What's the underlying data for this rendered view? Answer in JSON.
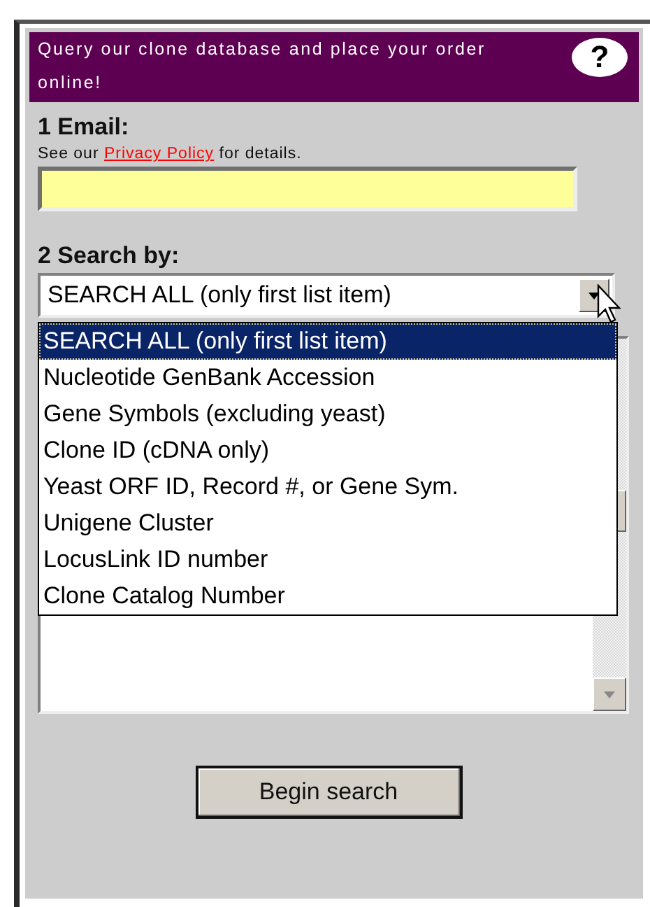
{
  "header": {
    "text": "Query our clone database and place your order online!",
    "help": "?"
  },
  "email": {
    "label": "1 Email:",
    "note_before": "See our ",
    "note_link": "Privacy Policy",
    "note_after": " for details."
  },
  "search_by": {
    "label": "2 Search by:",
    "value": "SEARCH ALL (only first list item)",
    "expanded": true,
    "options": [
      {
        "label": "SEARCH ALL (only first list item)",
        "selected": true
      },
      {
        "label": "Nucleotide GenBank Accession",
        "selected": false
      },
      {
        "label": "Gene Symbols (excluding yeast)",
        "selected": false
      },
      {
        "label": "Clone ID (cDNA only)",
        "selected": false
      },
      {
        "label": "Yeast ORF ID, Record #, or Gene Sym.",
        "selected": false
      },
      {
        "label": "Unigene Cluster",
        "selected": false
      },
      {
        "label": "LocusLink ID number",
        "selected": false
      },
      {
        "label": "Clone Catalog Number",
        "selected": false
      }
    ]
  },
  "button": "Begin search"
}
